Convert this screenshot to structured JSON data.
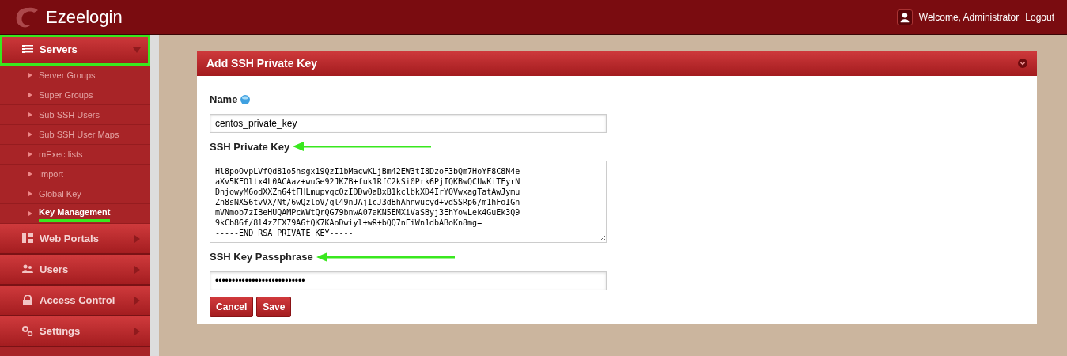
{
  "header": {
    "brand": "Ezeelogin",
    "welcome": "Welcome, Administrator",
    "logout": "Logout"
  },
  "sidebar": {
    "items": [
      {
        "label": "Servers",
        "expanded": true,
        "highlighted": true,
        "children": [
          {
            "label": "Server Groups",
            "selected": false,
            "highlighted": false
          },
          {
            "label": "Super Groups",
            "selected": false,
            "highlighted": false
          },
          {
            "label": "Sub SSH Users",
            "selected": false,
            "highlighted": false
          },
          {
            "label": "Sub SSH User Maps",
            "selected": false,
            "highlighted": false
          },
          {
            "label": "mExec lists",
            "selected": false,
            "highlighted": false
          },
          {
            "label": "Import",
            "selected": false,
            "highlighted": false
          },
          {
            "label": "Global Key",
            "selected": false,
            "highlighted": false
          },
          {
            "label": "Key Management",
            "selected": true,
            "highlighted": true
          }
        ]
      },
      {
        "label": "Web Portals",
        "expanded": false,
        "highlighted": false
      },
      {
        "label": "Users",
        "expanded": false,
        "highlighted": false
      },
      {
        "label": "Access Control",
        "expanded": false,
        "highlighted": false
      },
      {
        "label": "Settings",
        "expanded": false,
        "highlighted": false
      }
    ]
  },
  "panel": {
    "title": "Add SSH Private Key",
    "fields": [
      {
        "kind": "text",
        "label": "Name",
        "help": true,
        "annotated": false,
        "value": "centos_private_key"
      },
      {
        "kind": "textarea",
        "label": "SSH Private Key",
        "help": false,
        "annotated": true,
        "lines": [
          "Hl8poOvpLVfQd81o5hsgx19QzI1bMacwKLjBm42EW3tI8DzoF3bQm7HoYF8C8N4e",
          "aXv5KEOltx4L0ACAaz+wuGe92JKZB+fuk1RfC2kSi0Prk6PjIQKBwQCUwKiTFyrN",
          "DnjowyM6odXXZn64tFHLmupvqcQzIDDw0aBxB1kclbkXD4IrYQVwxagTatAwJymu",
          "Zn8sNXS6tvVX/Nt/6wQzloV/ql49nJAjIcJ3dBhAhnwucyd+vdSSRp6/m1hFoIGn",
          "mVNmob7zIBeHUQAMPcWWtQrQG79bnwA07aKN5EMXiVaSByj3EhYowLek4GuEk3Q9",
          "9kCb86f/8l4zZFX79A6tQK7KAoDwiyl+wR+bQQ7nFiWn1dbABoKn8mg=",
          "-----END RSA PRIVATE KEY-----"
        ]
      },
      {
        "kind": "password",
        "label": "SSH Key Passphrase",
        "help": false,
        "annotated": true,
        "value": "•••••••••••••••••••••••••••"
      }
    ],
    "buttons": [
      "Cancel",
      "Save"
    ]
  }
}
